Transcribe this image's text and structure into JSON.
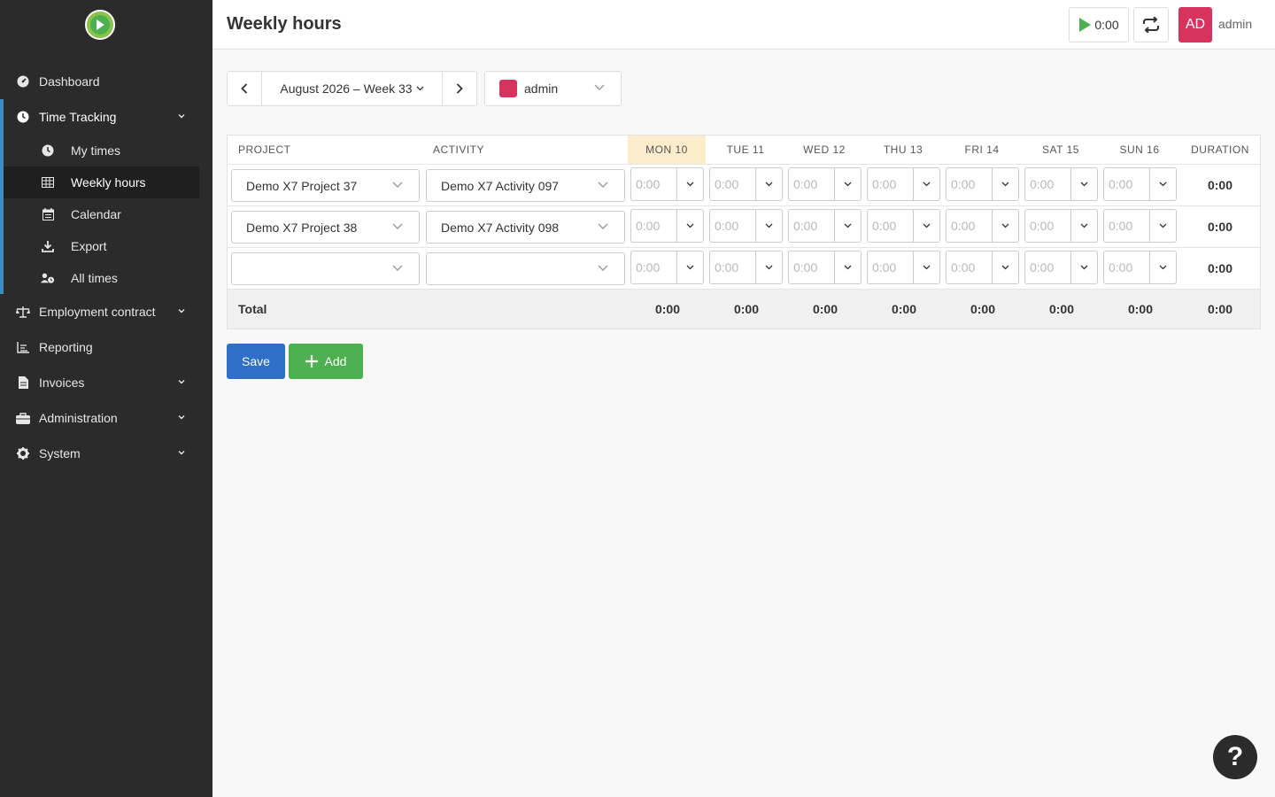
{
  "app": {
    "brand_color": "#8bc34a",
    "accent": "#3c8dbc"
  },
  "sidebar": {
    "items": [
      {
        "label": "Dashboard",
        "icon": "dashboard-icon"
      },
      {
        "label": "Time Tracking",
        "icon": "clock-icon",
        "expanded": true
      },
      {
        "label": "Employment contract",
        "icon": "scale-icon"
      },
      {
        "label": "Reporting",
        "icon": "chart-icon"
      },
      {
        "label": "Invoices",
        "icon": "invoice-icon"
      },
      {
        "label": "Administration",
        "icon": "toolbox-icon"
      },
      {
        "label": "System",
        "icon": "gear-icon"
      }
    ],
    "sub_items": [
      {
        "label": "My times",
        "icon": "clock-icon"
      },
      {
        "label": "Weekly hours",
        "icon": "table-icon",
        "active": true
      },
      {
        "label": "Calendar",
        "icon": "calendar-icon"
      },
      {
        "label": "Export",
        "icon": "download-icon"
      },
      {
        "label": "All times",
        "icon": "users-clock-icon"
      }
    ]
  },
  "header": {
    "title": "Weekly hours",
    "timer": "0:00",
    "avatar_initials": "AD",
    "avatar_color": "#d7335f",
    "username": "admin"
  },
  "filters": {
    "week_label": "August 2026 – Week 33",
    "user_label": "admin",
    "user_color": "#d7335f"
  },
  "table": {
    "headers": {
      "project": "PROJECT",
      "activity": "ACTIVITY",
      "days": [
        "MON 10",
        "TUE 11",
        "WED 12",
        "THU 13",
        "FRI 14",
        "SAT 15",
        "SUN 16"
      ],
      "duration": "DURATION"
    },
    "today_index": 0,
    "placeholder": "0:00",
    "rows": [
      {
        "project": "Demo X7 Project 37",
        "activity": "Demo X7 Activity 097",
        "duration": "0:00"
      },
      {
        "project": "Demo X7 Project 38",
        "activity": "Demo X7 Activity 098",
        "duration": "0:00"
      },
      {
        "project": "",
        "activity": "",
        "duration": "0:00"
      }
    ],
    "total": {
      "label": "Total",
      "days": [
        "0:00",
        "0:00",
        "0:00",
        "0:00",
        "0:00",
        "0:00",
        "0:00"
      ],
      "duration": "0:00"
    }
  },
  "actions": {
    "save_label": "Save",
    "add_label": "Add"
  },
  "help": {
    "label": "?"
  }
}
